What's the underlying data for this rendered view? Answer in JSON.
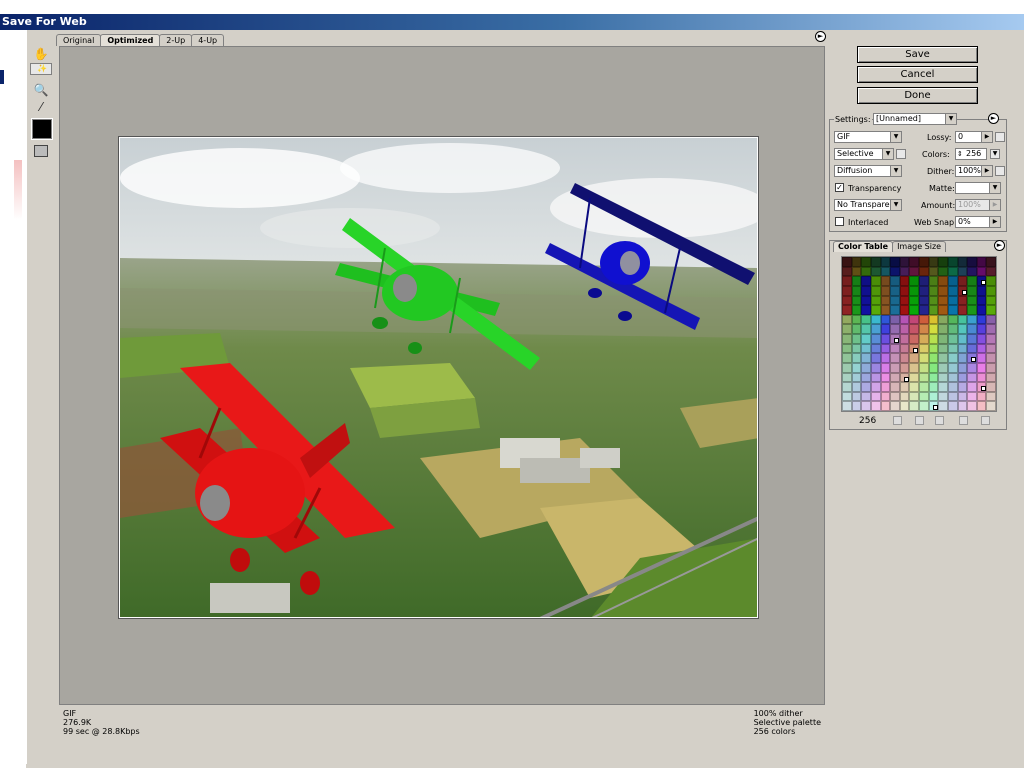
{
  "window": {
    "title": "Save For Web"
  },
  "tabs": [
    "Original",
    "Optimized",
    "2-Up",
    "4-Up"
  ],
  "buttons": {
    "save": "Save",
    "cancel": "Cancel",
    "done": "Done"
  },
  "settings": {
    "label": "Settings:",
    "preset": "[Unnamed]",
    "format": "GIF",
    "lossy_label": "Lossy:",
    "lossy": "0",
    "palette": "Selective",
    "colors_label": "Colors:",
    "colors": "256",
    "dither_algo": "Diffusion",
    "dither_label": "Dither:",
    "dither": "100%",
    "transparency_label": "Transparency",
    "transparency_checked": true,
    "matte_label": "Matte:",
    "transparency_dither": "No Transparen...",
    "amount_label": "Amount:",
    "amount": "100%",
    "interlaced_label": "Interlaced",
    "interlaced_checked": false,
    "websnap_label": "Web Snap:",
    "websnap": "0%"
  },
  "color_table": {
    "tabs": [
      "Color Table",
      "Image Size"
    ],
    "count": "256"
  },
  "status": {
    "left": [
      "GIF",
      "276.9K",
      "99 sec @ 28.8Kbps"
    ],
    "right": [
      "100% dither",
      "Selective palette",
      "256 colors"
    ]
  },
  "colors": {
    "title_bar": "#0a246a",
    "plane_red": "#e01010",
    "plane_green": "#20d020",
    "plane_blue": "#1010c0"
  }
}
